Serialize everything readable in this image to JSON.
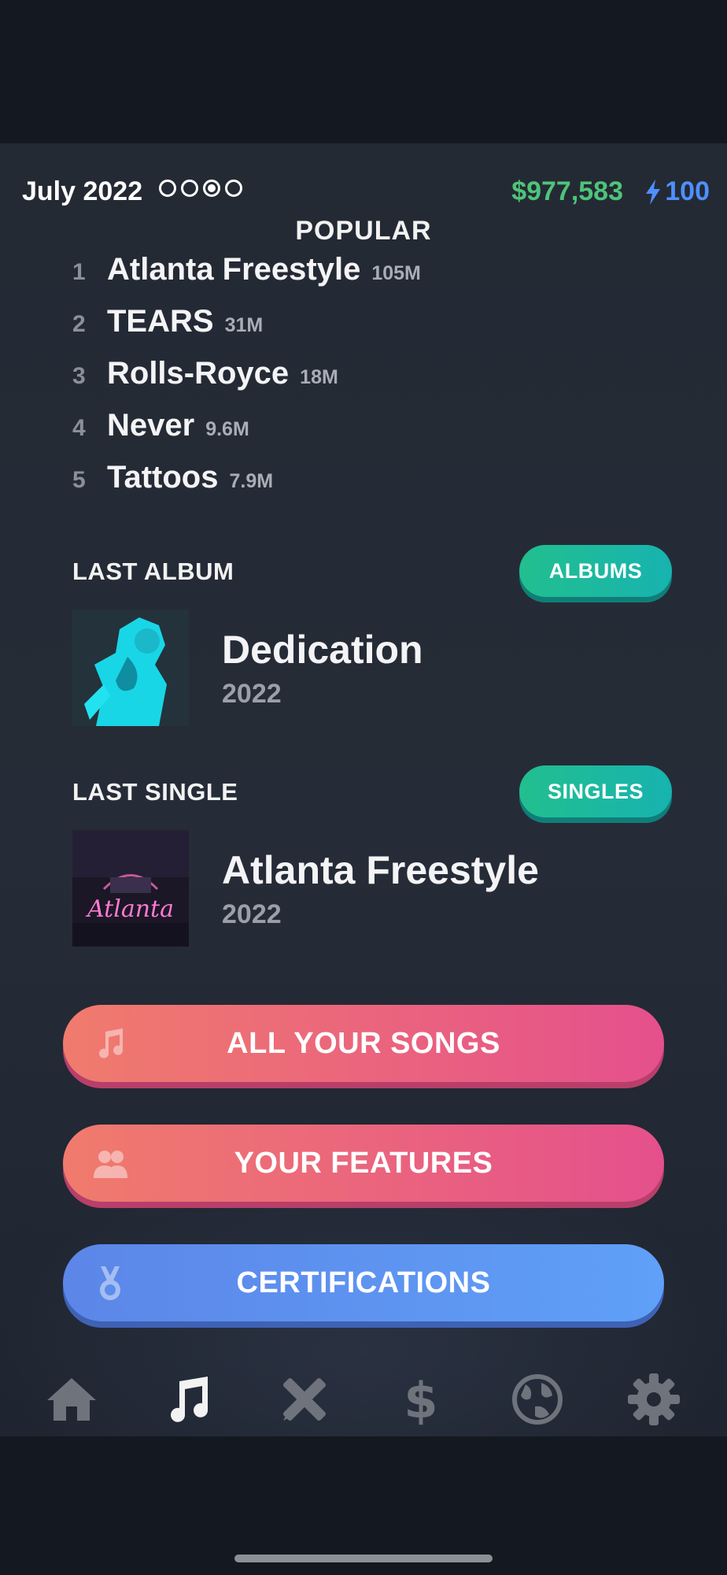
{
  "status": {
    "date": "July 2022",
    "week_indicator": [
      "empty",
      "empty",
      "filled",
      "empty"
    ],
    "money": "$977,583",
    "energy": "100"
  },
  "popular": {
    "title": "POPULAR",
    "songs": [
      {
        "rank": "1",
        "name": "Atlanta Freestyle",
        "plays": "105M"
      },
      {
        "rank": "2",
        "name": "TEARS",
        "plays": "31M"
      },
      {
        "rank": "3",
        "name": "Rolls-Royce",
        "plays": "18M"
      },
      {
        "rank": "4",
        "name": "Never",
        "plays": "9.6M"
      },
      {
        "rank": "5",
        "name": "Tattoos",
        "plays": "7.9M"
      }
    ]
  },
  "last_album": {
    "label": "LAST ALBUM",
    "button": "ALBUMS",
    "title": "Dedication",
    "year": "2022"
  },
  "last_single": {
    "label": "LAST SINGLE",
    "button": "SINGLES",
    "title": "Atlanta Freestyle",
    "year": "2022",
    "cover_text": "Atlanta"
  },
  "actions": {
    "all_songs": "ALL YOUR SONGS",
    "features": "YOUR FEATURES",
    "certifications": "CERTIFICATIONS"
  },
  "tabs": [
    "home-icon",
    "music-note-icon",
    "pencil-ruler-icon",
    "dollar-icon",
    "globe-icon",
    "gear-icon"
  ],
  "colors": {
    "money": "#4ec479",
    "energy": "#4f8fff",
    "teal_button": "#1bb9a0",
    "pink_button": "#e9637e",
    "blue_button": "#5f95f0",
    "active_tab": "#f2f2f2",
    "inactive_tab": "#6e737c"
  }
}
